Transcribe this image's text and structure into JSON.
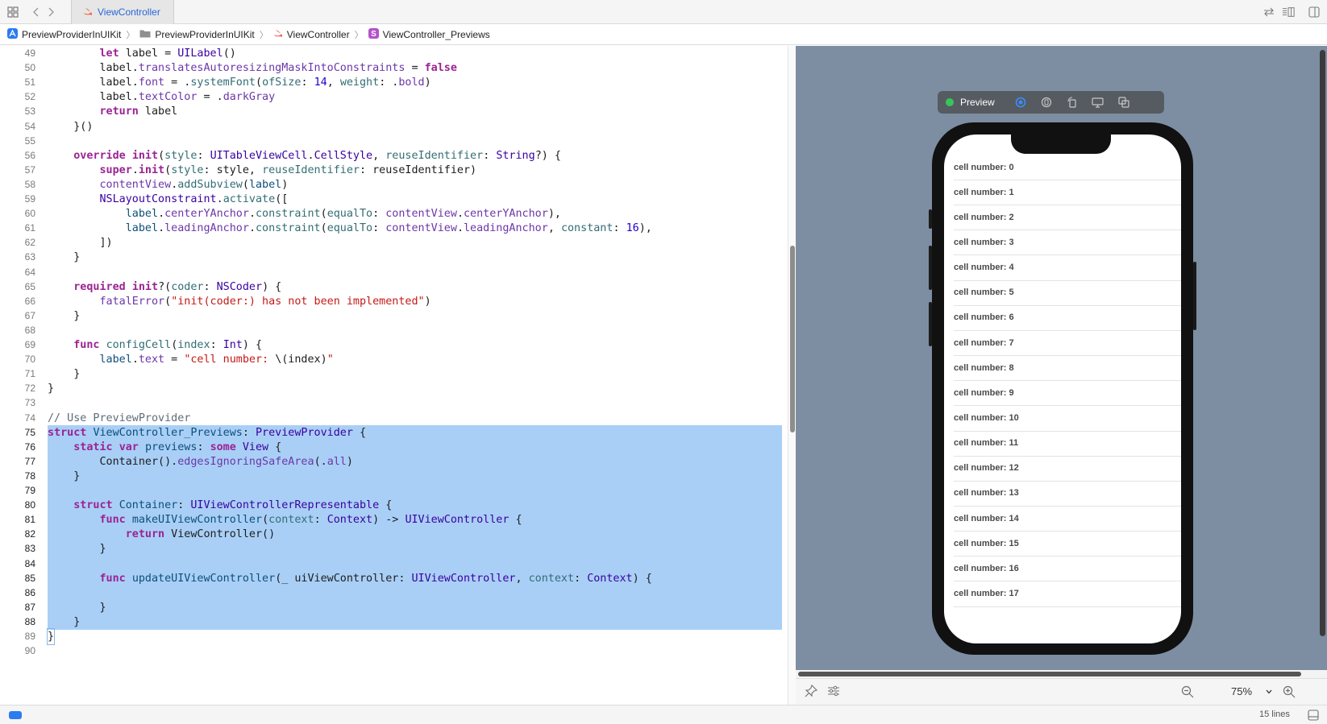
{
  "tab": {
    "title": "ViewController"
  },
  "breadcrumb": [
    "PreviewProviderInUIKit",
    "PreviewProviderInUIKit",
    "ViewController",
    "ViewController_Previews"
  ],
  "code": [
    {
      "n": "49",
      "sel": false,
      "t": [
        [
          "",
          "        "
        ],
        [
          "kw",
          "let"
        ],
        [
          "",
          " label = "
        ],
        [
          "ty2",
          "UILabel"
        ],
        [
          "",
          "()"
        ]
      ]
    },
    {
      "n": "50",
      "sel": false,
      "t": [
        [
          "",
          "        label."
        ],
        [
          "prop",
          "translatesAutoresizingMaskIntoConstraints"
        ],
        [
          "",
          " = "
        ],
        [
          "kw",
          "false"
        ]
      ]
    },
    {
      "n": "51",
      "sel": false,
      "t": [
        [
          "",
          "        label."
        ],
        [
          "prop",
          "font"
        ],
        [
          "",
          " = ."
        ],
        [
          "fn",
          "systemFont"
        ],
        [
          "",
          "("
        ],
        [
          "fn",
          "ofSize"
        ],
        [
          "",
          ": "
        ],
        [
          "num",
          "14"
        ],
        [
          "",
          ", "
        ],
        [
          "fn",
          "weight"
        ],
        [
          "",
          ": ."
        ],
        [
          "prop",
          "bold"
        ],
        [
          "",
          ")"
        ]
      ]
    },
    {
      "n": "52",
      "sel": false,
      "t": [
        [
          "",
          "        label."
        ],
        [
          "prop",
          "textColor"
        ],
        [
          "",
          " = ."
        ],
        [
          "prop",
          "darkGray"
        ]
      ]
    },
    {
      "n": "53",
      "sel": false,
      "t": [
        [
          "",
          "        "
        ],
        [
          "kw",
          "return"
        ],
        [
          "",
          " label"
        ]
      ]
    },
    {
      "n": "54",
      "sel": false,
      "t": [
        [
          "",
          "    }()"
        ]
      ]
    },
    {
      "n": "55",
      "sel": false,
      "t": [
        [
          "",
          ""
        ]
      ]
    },
    {
      "n": "56",
      "sel": false,
      "t": [
        [
          "",
          "    "
        ],
        [
          "kw",
          "override"
        ],
        [
          "",
          " "
        ],
        [
          "kw",
          "init"
        ],
        [
          "",
          "("
        ],
        [
          "fn",
          "style"
        ],
        [
          "",
          ": "
        ],
        [
          "ty2",
          "UITableViewCell"
        ],
        [
          "",
          "."
        ],
        [
          "ty2",
          "CellStyle"
        ],
        [
          "",
          ", "
        ],
        [
          "fn",
          "reuseIdentifier"
        ],
        [
          "",
          ": "
        ],
        [
          "ty2",
          "String"
        ],
        [
          "",
          "?) {"
        ]
      ]
    },
    {
      "n": "57",
      "sel": false,
      "t": [
        [
          "",
          "        "
        ],
        [
          "kw",
          "super"
        ],
        [
          "",
          "."
        ],
        [
          "kw",
          "init"
        ],
        [
          "",
          "("
        ],
        [
          "fn",
          "style"
        ],
        [
          "",
          ": style, "
        ],
        [
          "fn",
          "reuseIdentifier"
        ],
        [
          "",
          ": reuseIdentifier)"
        ]
      ]
    },
    {
      "n": "58",
      "sel": false,
      "t": [
        [
          "",
          "        "
        ],
        [
          "prop",
          "contentView"
        ],
        [
          "",
          "."
        ],
        [
          "fn",
          "addSubview"
        ],
        [
          "",
          "("
        ],
        [
          "ty",
          "label"
        ],
        [
          "",
          ")"
        ]
      ]
    },
    {
      "n": "59",
      "sel": false,
      "t": [
        [
          "",
          "        "
        ],
        [
          "ty2",
          "NSLayoutConstraint"
        ],
        [
          "",
          "."
        ],
        [
          "fn",
          "activate"
        ],
        [
          "",
          "(["
        ]
      ]
    },
    {
      "n": "60",
      "sel": false,
      "t": [
        [
          "",
          "            "
        ],
        [
          "ty",
          "label"
        ],
        [
          "",
          "."
        ],
        [
          "prop",
          "centerYAnchor"
        ],
        [
          "",
          "."
        ],
        [
          "fn",
          "constraint"
        ],
        [
          "",
          "("
        ],
        [
          "fn",
          "equalTo"
        ],
        [
          "",
          ": "
        ],
        [
          "prop",
          "contentView"
        ],
        [
          "",
          "."
        ],
        [
          "prop",
          "centerYAnchor"
        ],
        [
          "",
          "),"
        ]
      ]
    },
    {
      "n": "61",
      "sel": false,
      "t": [
        [
          "",
          "            "
        ],
        [
          "ty",
          "label"
        ],
        [
          "",
          "."
        ],
        [
          "prop",
          "leadingAnchor"
        ],
        [
          "",
          "."
        ],
        [
          "fn",
          "constraint"
        ],
        [
          "",
          "("
        ],
        [
          "fn",
          "equalTo"
        ],
        [
          "",
          ": "
        ],
        [
          "prop",
          "contentView"
        ],
        [
          "",
          "."
        ],
        [
          "prop",
          "leadingAnchor"
        ],
        [
          "",
          ", "
        ],
        [
          "fn",
          "constant"
        ],
        [
          "",
          ": "
        ],
        [
          "num",
          "16"
        ],
        [
          "",
          "),"
        ]
      ]
    },
    {
      "n": "62",
      "sel": false,
      "t": [
        [
          "",
          "        ])"
        ]
      ]
    },
    {
      "n": "63",
      "sel": false,
      "t": [
        [
          "",
          "    }"
        ]
      ]
    },
    {
      "n": "64",
      "sel": false,
      "t": [
        [
          "",
          ""
        ]
      ]
    },
    {
      "n": "65",
      "sel": false,
      "t": [
        [
          "",
          "    "
        ],
        [
          "kw",
          "required"
        ],
        [
          "",
          " "
        ],
        [
          "kw",
          "init"
        ],
        [
          "",
          "?("
        ],
        [
          "fn",
          "coder"
        ],
        [
          "",
          ": "
        ],
        [
          "ty2",
          "NSCoder"
        ],
        [
          "",
          ") {"
        ]
      ]
    },
    {
      "n": "66",
      "sel": false,
      "t": [
        [
          "",
          "        "
        ],
        [
          "prop",
          "fatalError"
        ],
        [
          "",
          "("
        ],
        [
          "str",
          "\"init(coder:) has not been implemented\""
        ],
        [
          "",
          ")"
        ]
      ]
    },
    {
      "n": "67",
      "sel": false,
      "t": [
        [
          "",
          "    }"
        ]
      ]
    },
    {
      "n": "68",
      "sel": false,
      "t": [
        [
          "",
          ""
        ]
      ]
    },
    {
      "n": "69",
      "sel": false,
      "t": [
        [
          "",
          "    "
        ],
        [
          "kw",
          "func"
        ],
        [
          "",
          " "
        ],
        [
          "fn",
          "configCell"
        ],
        [
          "",
          "("
        ],
        [
          "fn",
          "index"
        ],
        [
          "",
          ": "
        ],
        [
          "ty2",
          "Int"
        ],
        [
          "",
          ") {"
        ]
      ]
    },
    {
      "n": "70",
      "sel": false,
      "t": [
        [
          "",
          "        "
        ],
        [
          "ty",
          "label"
        ],
        [
          "",
          "."
        ],
        [
          "prop",
          "text"
        ],
        [
          "",
          " = "
        ],
        [
          "str",
          "\"cell number: "
        ],
        [
          "",
          "\\(index)"
        ],
        [
          "str",
          "\""
        ]
      ]
    },
    {
      "n": "71",
      "sel": false,
      "t": [
        [
          "",
          "    }"
        ]
      ]
    },
    {
      "n": "72",
      "sel": false,
      "t": [
        [
          "",
          "}"
        ]
      ]
    },
    {
      "n": "73",
      "sel": false,
      "t": [
        [
          "",
          ""
        ]
      ]
    },
    {
      "n": "74",
      "sel": false,
      "t": [
        [
          "cmt",
          "// Use PreviewProvider"
        ]
      ]
    },
    {
      "n": "75",
      "sel": true,
      "t": [
        [
          "kw",
          "struct"
        ],
        [
          "",
          " "
        ],
        [
          "ty",
          "ViewController_Previews"
        ],
        [
          "",
          ": "
        ],
        [
          "ty2",
          "PreviewProvider"
        ],
        [
          "",
          " {"
        ]
      ]
    },
    {
      "n": "76",
      "sel": true,
      "t": [
        [
          "",
          "    "
        ],
        [
          "kw",
          "static"
        ],
        [
          "",
          " "
        ],
        [
          "kw",
          "var"
        ],
        [
          "",
          " "
        ],
        [
          "ty",
          "previews"
        ],
        [
          "",
          ": "
        ],
        [
          "kw",
          "some"
        ],
        [
          "",
          " "
        ],
        [
          "ty2",
          "View"
        ],
        [
          "",
          " {"
        ]
      ]
    },
    {
      "n": "77",
      "sel": true,
      "t": [
        [
          "",
          "        Container()."
        ],
        [
          "prop",
          "edgesIgnoringSafeArea"
        ],
        [
          "",
          "(."
        ],
        [
          "prop",
          "all"
        ],
        [
          "",
          ")"
        ]
      ]
    },
    {
      "n": "78",
      "sel": true,
      "t": [
        [
          "",
          "    }"
        ]
      ]
    },
    {
      "n": "79",
      "sel": true,
      "t": [
        [
          "",
          ""
        ]
      ]
    },
    {
      "n": "80",
      "sel": true,
      "t": [
        [
          "",
          "    "
        ],
        [
          "kw",
          "struct"
        ],
        [
          "",
          " "
        ],
        [
          "ty",
          "Container"
        ],
        [
          "",
          ": "
        ],
        [
          "ty2",
          "UIViewControllerRepresentable"
        ],
        [
          "",
          " {"
        ]
      ]
    },
    {
      "n": "81",
      "sel": true,
      "t": [
        [
          "",
          "        "
        ],
        [
          "kw",
          "func"
        ],
        [
          "",
          " "
        ],
        [
          "ty",
          "makeUIViewController"
        ],
        [
          "",
          "("
        ],
        [
          "fn",
          "context"
        ],
        [
          "",
          ": "
        ],
        [
          "ty2",
          "Context"
        ],
        [
          "",
          ") -> "
        ],
        [
          "ty2",
          "UIViewController"
        ],
        [
          "",
          " {"
        ]
      ]
    },
    {
      "n": "82",
      "sel": true,
      "t": [
        [
          "",
          "            "
        ],
        [
          "kw",
          "return"
        ],
        [
          "",
          " ViewController()"
        ]
      ]
    },
    {
      "n": "83",
      "sel": true,
      "t": [
        [
          "",
          "        }"
        ]
      ]
    },
    {
      "n": "84",
      "sel": true,
      "t": [
        [
          "",
          ""
        ]
      ]
    },
    {
      "n": "85",
      "sel": true,
      "t": [
        [
          "",
          "        "
        ],
        [
          "kw",
          "func"
        ],
        [
          "",
          " "
        ],
        [
          "ty",
          "updateUIViewController"
        ],
        [
          "",
          "(_ uiViewController: "
        ],
        [
          "ty2",
          "UIViewController"
        ],
        [
          "",
          ", "
        ],
        [
          "fn",
          "context"
        ],
        [
          "",
          ": "
        ],
        [
          "ty2",
          "Context"
        ],
        [
          "",
          ") {"
        ]
      ]
    },
    {
      "n": "86",
      "sel": true,
      "t": [
        [
          "",
          ""
        ]
      ]
    },
    {
      "n": "87",
      "sel": true,
      "t": [
        [
          "",
          "        }"
        ]
      ]
    },
    {
      "n": "88",
      "sel": true,
      "t": [
        [
          "",
          "    }"
        ]
      ]
    },
    {
      "n": "89",
      "sel": false,
      "caret": true,
      "t": [
        [
          "",
          "}"
        ]
      ]
    },
    {
      "n": "90",
      "sel": false,
      "t": [
        [
          "",
          ""
        ]
      ]
    }
  ],
  "preview": {
    "label": "Preview",
    "cells": [
      "cell number: 0",
      "cell number: 1",
      "cell number: 2",
      "cell number: 3",
      "cell number: 4",
      "cell number: 5",
      "cell number: 6",
      "cell number: 7",
      "cell number: 8",
      "cell number: 9",
      "cell number: 10",
      "cell number: 11",
      "cell number: 12",
      "cell number: 13",
      "cell number: 14",
      "cell number: 15",
      "cell number: 16",
      "cell number: 17"
    ]
  },
  "zoom": {
    "level": "75%"
  },
  "status": {
    "lines": "15 lines"
  },
  "colors": {
    "selection": "#a9cff6",
    "keyword": "#9b2393",
    "string": "#c41a16",
    "canvas": "#7d8ea3",
    "accent": "#2a7cf0"
  }
}
